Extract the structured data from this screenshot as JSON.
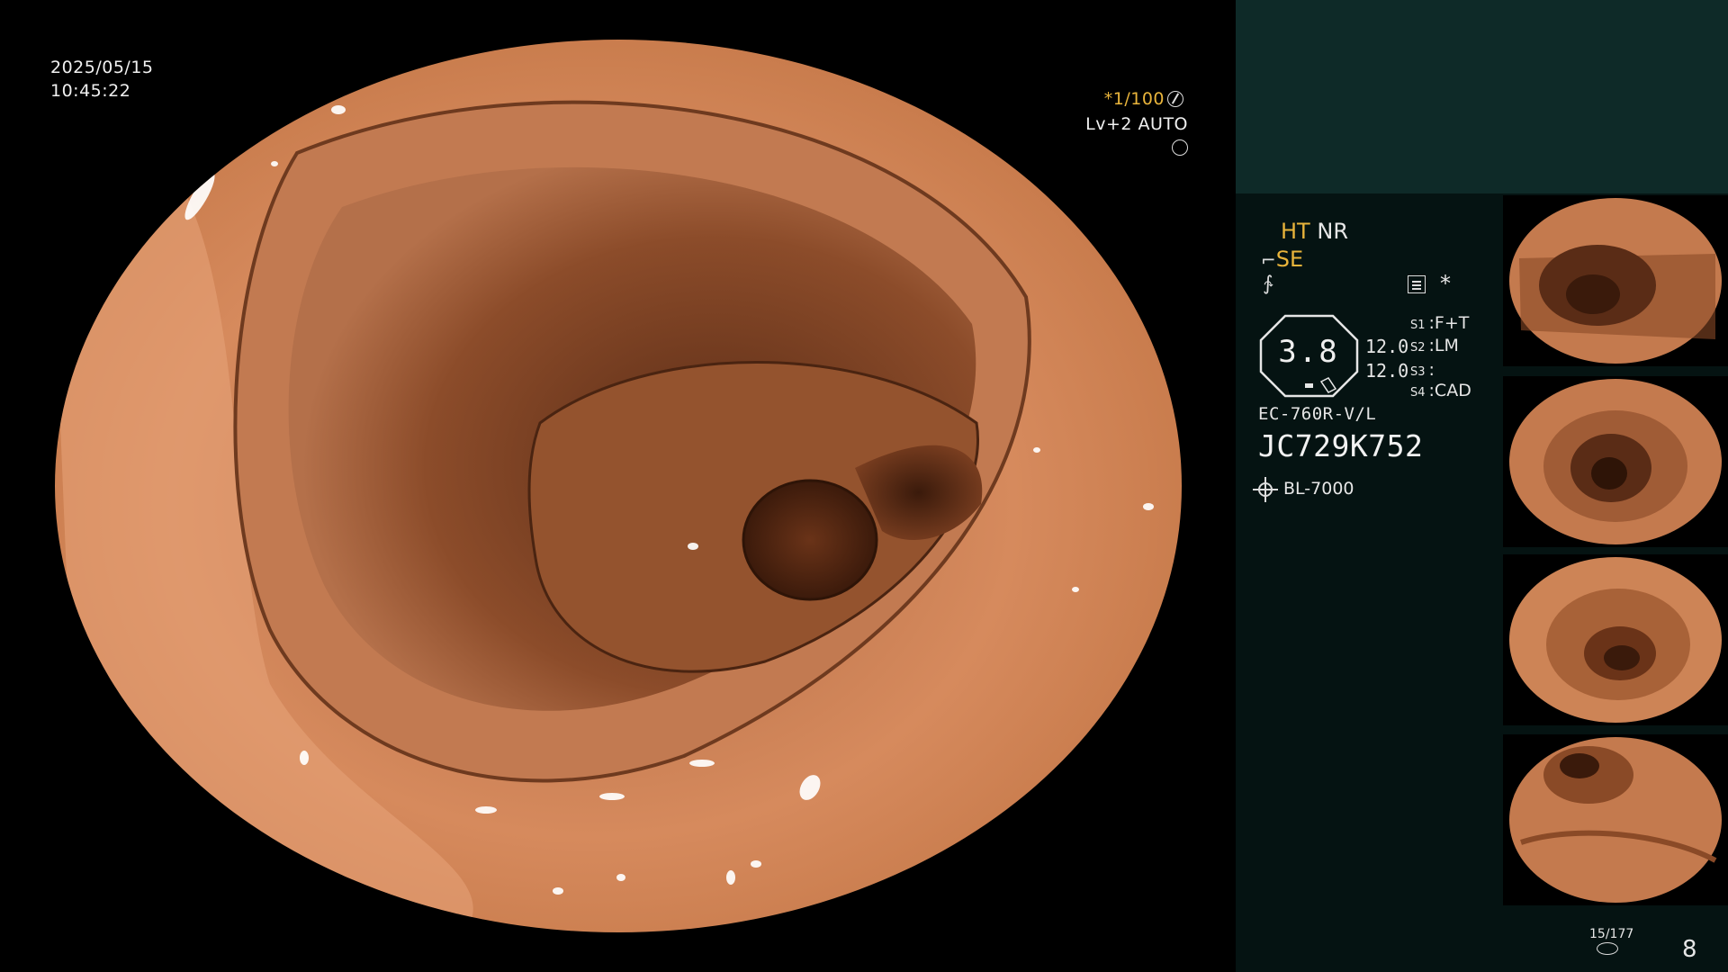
{
  "overlay": {
    "date": "2025/05/15",
    "time": "10:45:22",
    "shutter": "*1/100",
    "level": "Lv+2 AUTO"
  },
  "panel": {
    "ht": "HT",
    "nr": "NR",
    "se": "SE",
    "asterisk": "*",
    "octagon_value": "3.8",
    "value_a": "12.0",
    "value_b": "12.0",
    "switches": [
      {
        "key": "S1",
        "value": ":F+T"
      },
      {
        "key": "S2",
        "value": ":LM"
      },
      {
        "key": "S3",
        "value": ":"
      },
      {
        "key": "S4",
        "value": ":CAD"
      }
    ],
    "scope_model": "EC-760R-V/L",
    "serial": "JC729K752",
    "light_source": "BL-7000",
    "image_counter": "15/177",
    "page": "8"
  },
  "colors": {
    "tissue": "#c97a50",
    "tissue_shadow": "#5a2e17",
    "panel_bg": "#051312",
    "panel_band": "#0e2a28",
    "highlight_yellow": "#e9b43b"
  },
  "icons": {
    "shutter": "aperture-icon",
    "auto": "auto-iris-icon",
    "structure": "structure-enhance-icon",
    "freeze": "freeze-icon",
    "list": "menu-list-icon",
    "light": "light-source-icon",
    "record": "disk-icon"
  }
}
